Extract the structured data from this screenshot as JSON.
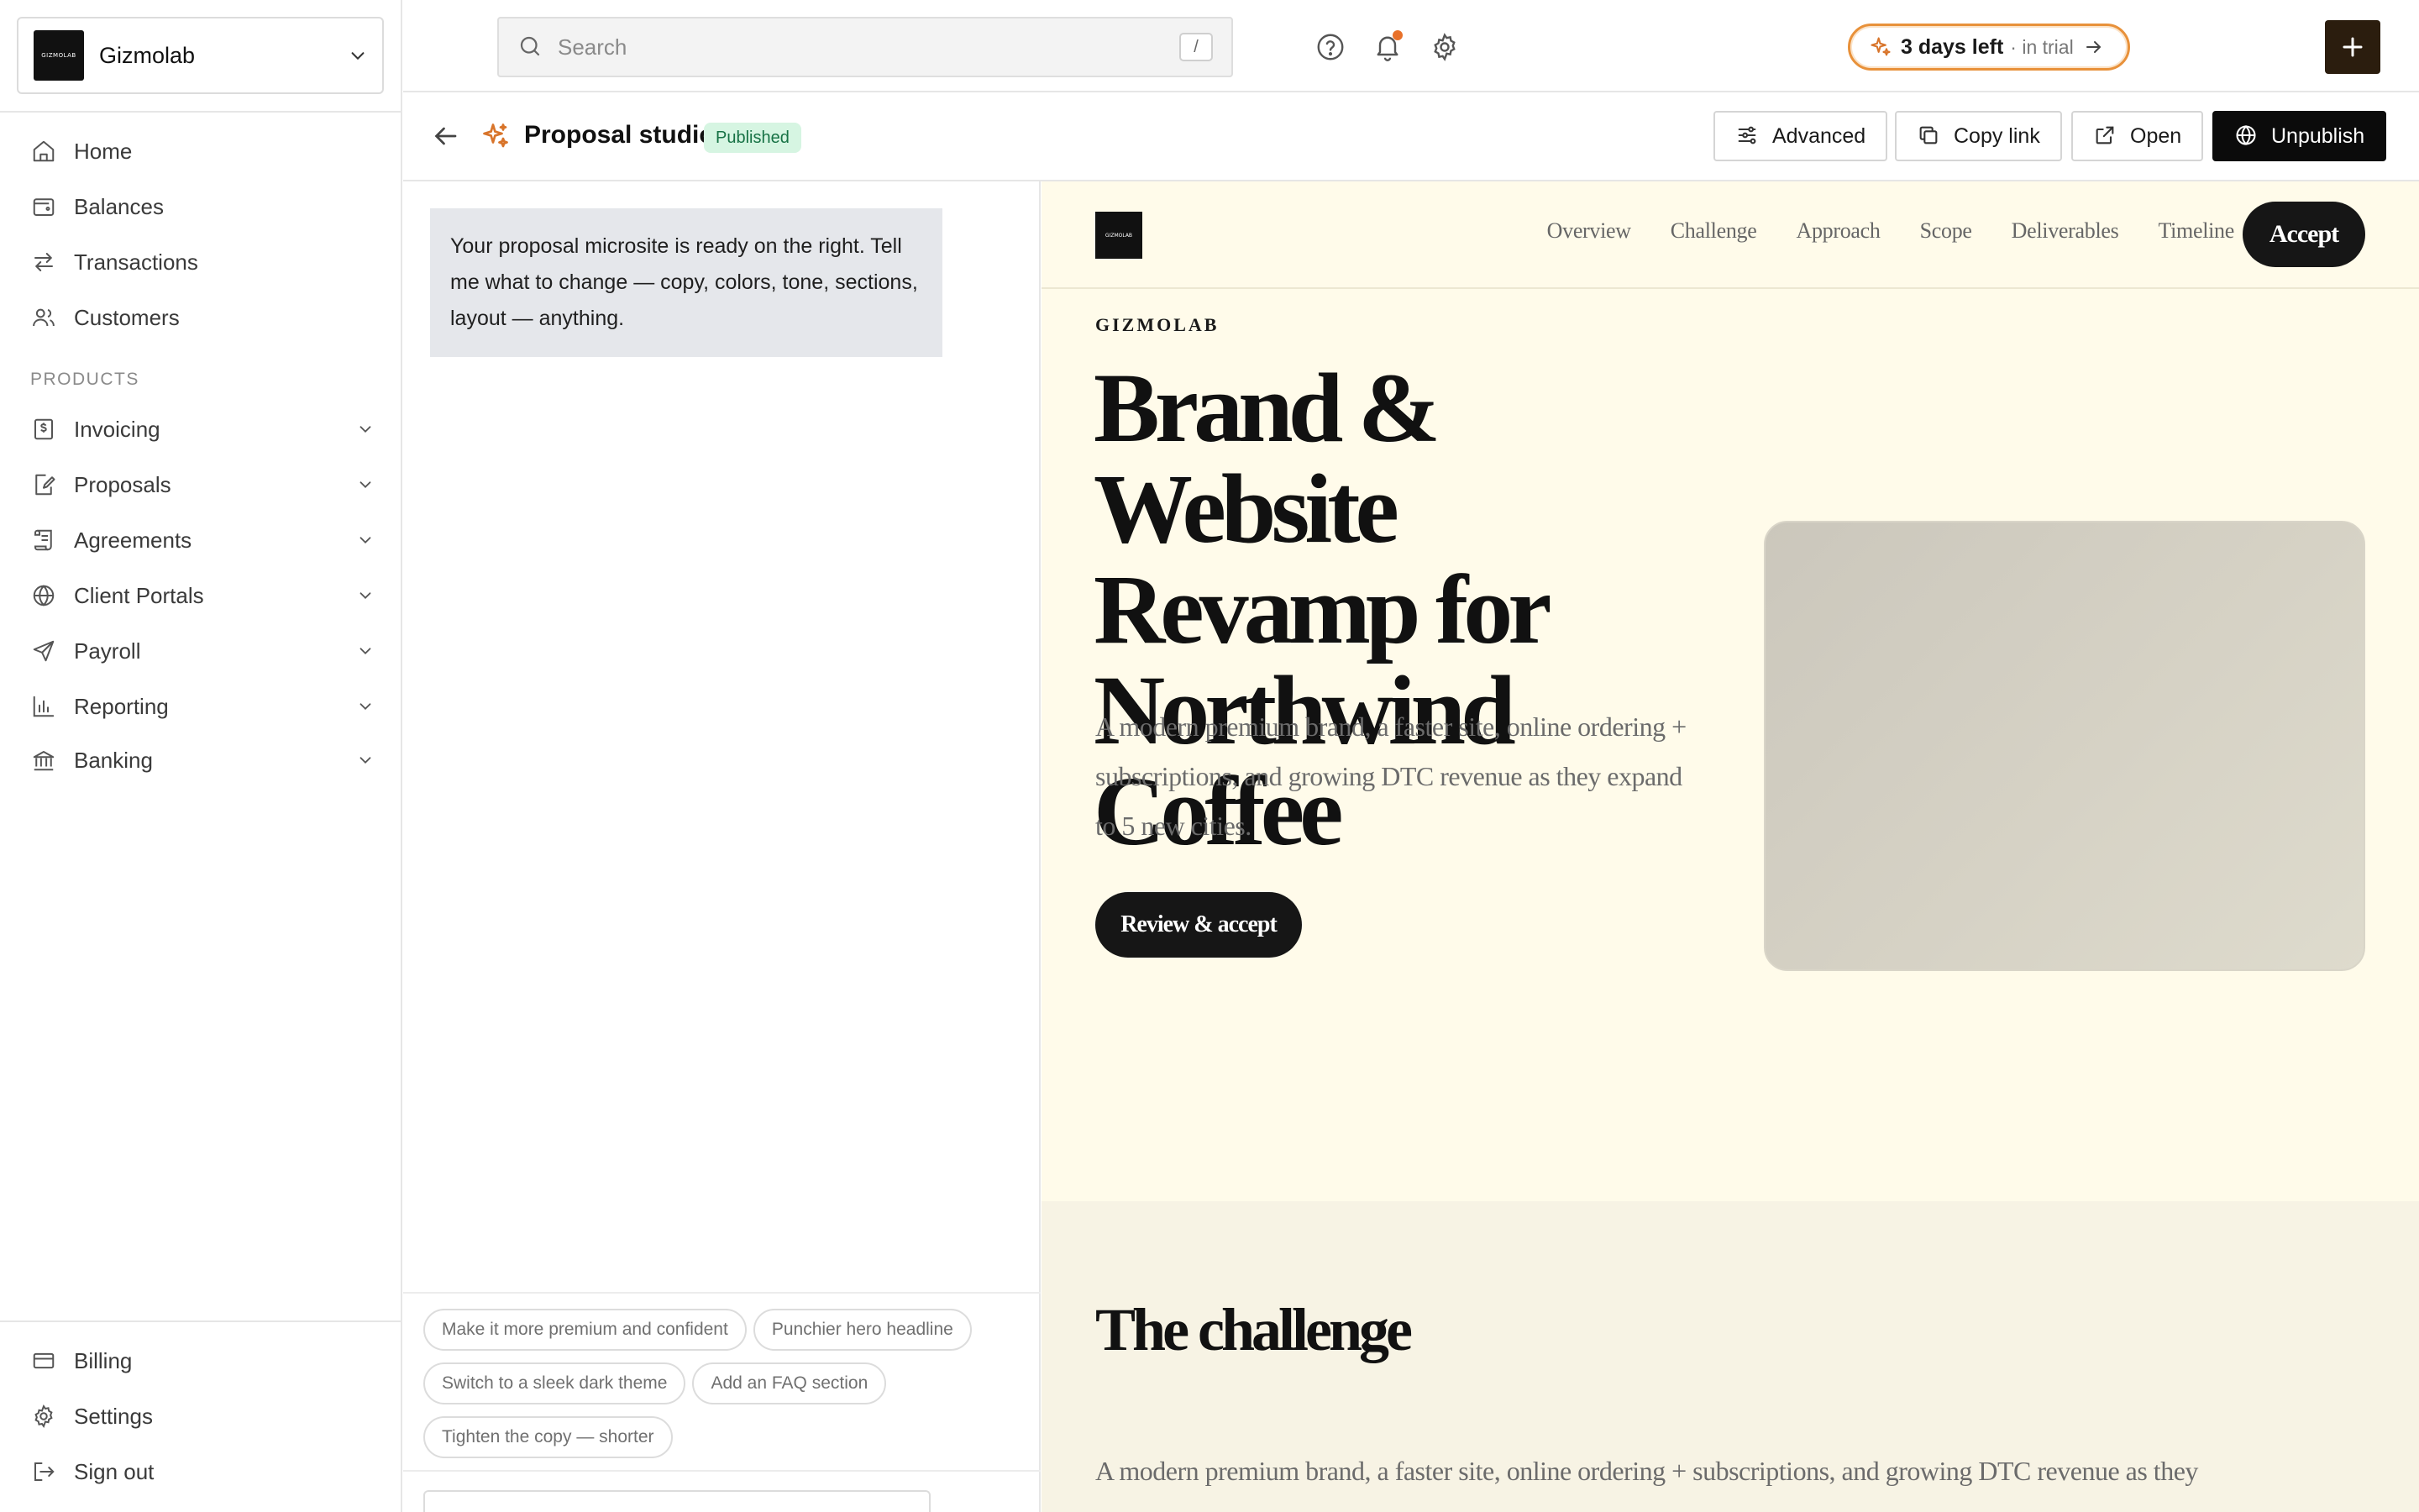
{
  "app": {
    "org_name": "Gizmolab",
    "org_logo_text": "GIZMOLAB"
  },
  "sidebar": {
    "main_items": [
      {
        "label": "Home",
        "icon": "home-icon"
      },
      {
        "label": "Balances",
        "icon": "wallet-icon"
      },
      {
        "label": "Transactions",
        "icon": "arrows-swap-icon"
      },
      {
        "label": "Customers",
        "icon": "users-icon"
      }
    ],
    "products_label": "PRODUCTS",
    "product_items": [
      {
        "label": "Invoicing",
        "icon": "invoice-dollar-icon"
      },
      {
        "label": "Proposals",
        "icon": "document-pen-icon"
      },
      {
        "label": "Agreements",
        "icon": "scroll-icon"
      },
      {
        "label": "Client Portals",
        "icon": "globe-icon"
      },
      {
        "label": "Payroll",
        "icon": "send-icon"
      },
      {
        "label": "Reporting",
        "icon": "bar-chart-icon"
      },
      {
        "label": "Banking",
        "icon": "bank-icon"
      }
    ],
    "footer_items": [
      {
        "label": "Billing",
        "icon": "credit-card-icon"
      },
      {
        "label": "Settings",
        "icon": "gear-icon"
      },
      {
        "label": "Sign out",
        "icon": "sign-out-icon"
      }
    ]
  },
  "topbar": {
    "search_placeholder": "Search",
    "search_shortcut": "/",
    "trial_strong": "3 days left",
    "trial_soft": "· in trial",
    "accent": "#e8913a"
  },
  "studio": {
    "title": "Proposal studio",
    "status": "Published",
    "buttons": {
      "advanced": "Advanced",
      "copy_link": "Copy link",
      "open": "Open",
      "unpublish": "Unpublish"
    }
  },
  "chat": {
    "assistant_message": "Your proposal microsite is ready on the right. Tell me what to change — copy, colors, tone, sections, layout — anything.",
    "suggestions": [
      "Make it more premium and confident",
      "Punchier hero headline",
      "Switch to a sleek dark theme",
      "Add an FAQ section",
      "Tighten the copy — shorter"
    ]
  },
  "preview": {
    "logo_text": "GIZMOLAB",
    "nav_links": [
      "Overview",
      "Challenge",
      "Approach",
      "Scope",
      "Deliverables",
      "Timeline"
    ],
    "accept_label": "Accept",
    "eyebrow": "GIZMOLAB",
    "hero_title": "Brand & Website Revamp for Northwind Coffee",
    "hero_subtitle": "A modern premium brand, a faster site, online ordering + subscriptions, and growing DTC revenue as they expand to 5 new cities.",
    "cta_label": "Review & accept",
    "challenge_heading": "The challenge",
    "challenge_text": "A modern premium brand, a faster site, online ordering + subscriptions, and growing DTC revenue as they",
    "background": "#fffbea"
  }
}
